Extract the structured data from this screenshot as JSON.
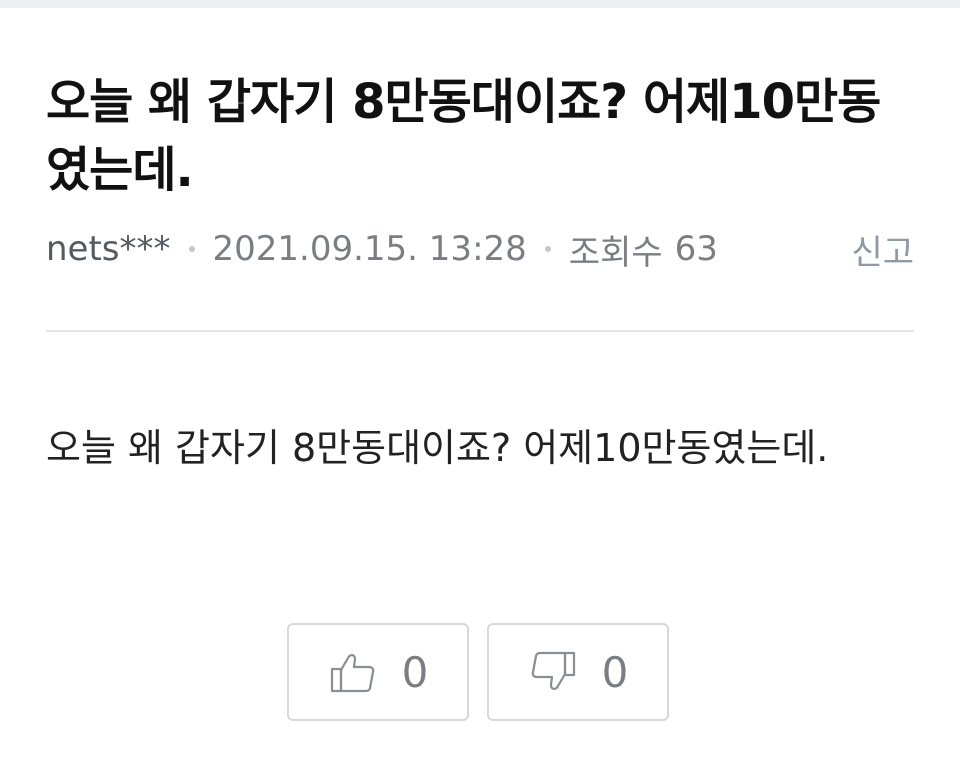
{
  "post": {
    "title": "오늘 왜 갑자기 8만동대이죠? 어제10만동였는데.",
    "author": "nets***",
    "datetime": "2021.09.15. 13:28",
    "views_label": "조회수",
    "views_count": "63",
    "report_label": "신고",
    "body": "오늘 왜 갑자기 8만동대이죠? 어제10만동였는데."
  },
  "votes": {
    "like": {
      "icon": "thumbs-up-icon",
      "count": "0"
    },
    "dislike": {
      "icon": "thumbs-down-icon",
      "count": "0"
    }
  },
  "colors": {
    "text": "#111111",
    "meta": "#7a7e83",
    "report": "#8e9aa6",
    "border": "#d6d8db",
    "divider": "#e4e6e8"
  }
}
